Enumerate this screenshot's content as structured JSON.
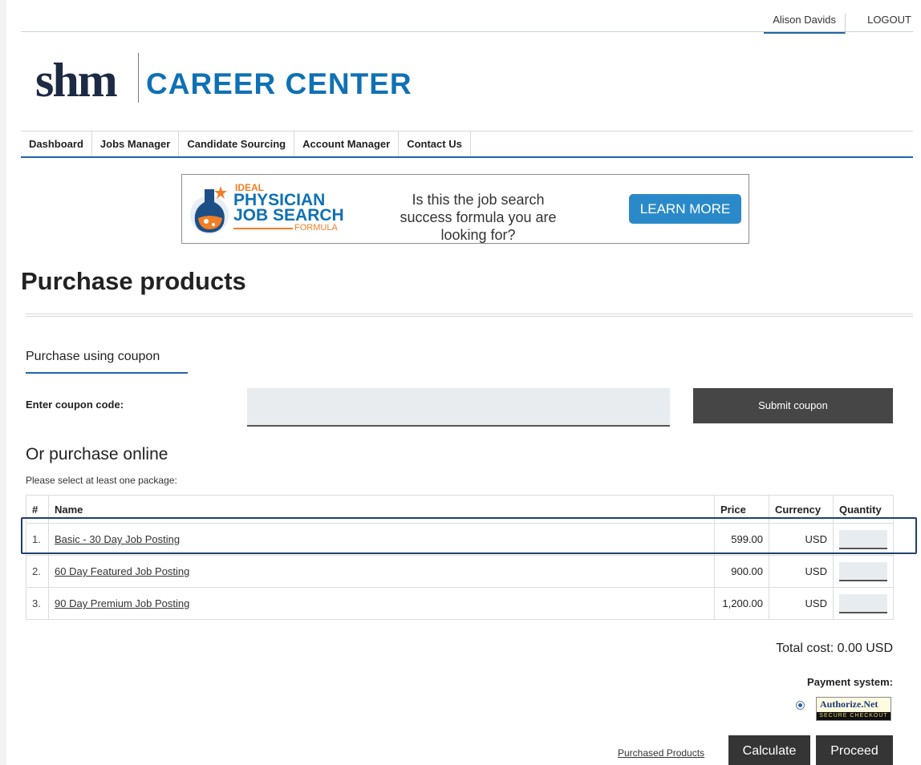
{
  "header": {
    "user_name": "Alison Davids",
    "logout_label": "LOGOUT"
  },
  "logo": {
    "brand": "shm",
    "title": "CAREER CENTER"
  },
  "nav": {
    "items": [
      {
        "label": "Dashboard"
      },
      {
        "label": "Jobs Manager"
      },
      {
        "label": "Candidate Sourcing"
      },
      {
        "label": "Account Manager"
      },
      {
        "label": "Contact Us"
      }
    ]
  },
  "banner": {
    "ideal": "IDEAL",
    "physician": "PHYSICIAN",
    "job_search": "JOB SEARCH",
    "formula": "FORMULA",
    "tagline": "Is this the job search success formula you are looking for?",
    "cta_label": "LEARN MORE"
  },
  "page_title": "Purchase products",
  "coupon": {
    "tab_label": "Purchase using coupon",
    "field_label": "Enter coupon code:",
    "input_value": "",
    "submit_label": "Submit coupon"
  },
  "online": {
    "title": "Or purchase online",
    "subtitle": "Please select at least one package:",
    "columns": {
      "num": "#",
      "name": "Name",
      "price": "Price",
      "currency": "Currency",
      "quantity": "Quantity"
    },
    "rows": [
      {
        "num": "1.",
        "name": "Basic - 30 Day Job Posting",
        "price": "599.00",
        "currency": "USD",
        "quantity": ""
      },
      {
        "num": "2.",
        "name": "60 Day Featured Job Posting",
        "price": "900.00",
        "currency": "USD",
        "quantity": ""
      },
      {
        "num": "3.",
        "name": "90 Day Premium Job Posting",
        "price": "1,200.00",
        "currency": "USD",
        "quantity": ""
      }
    ]
  },
  "summary": {
    "total_label": "Total cost: 0.00 USD",
    "payment_label": "Payment system:",
    "payment_option": {
      "brand": "Authorize.Net",
      "caption": "SECURE CHECKOUT"
    }
  },
  "actions": {
    "purchased_link": "Purchased Products",
    "calculate_label": "Calculate",
    "proceed_label": "Proceed"
  },
  "colors": {
    "accent_blue": "#1f65a6",
    "brand_blue": "#0f71b4",
    "orange": "#f07e26",
    "dark_button": "#353535"
  }
}
